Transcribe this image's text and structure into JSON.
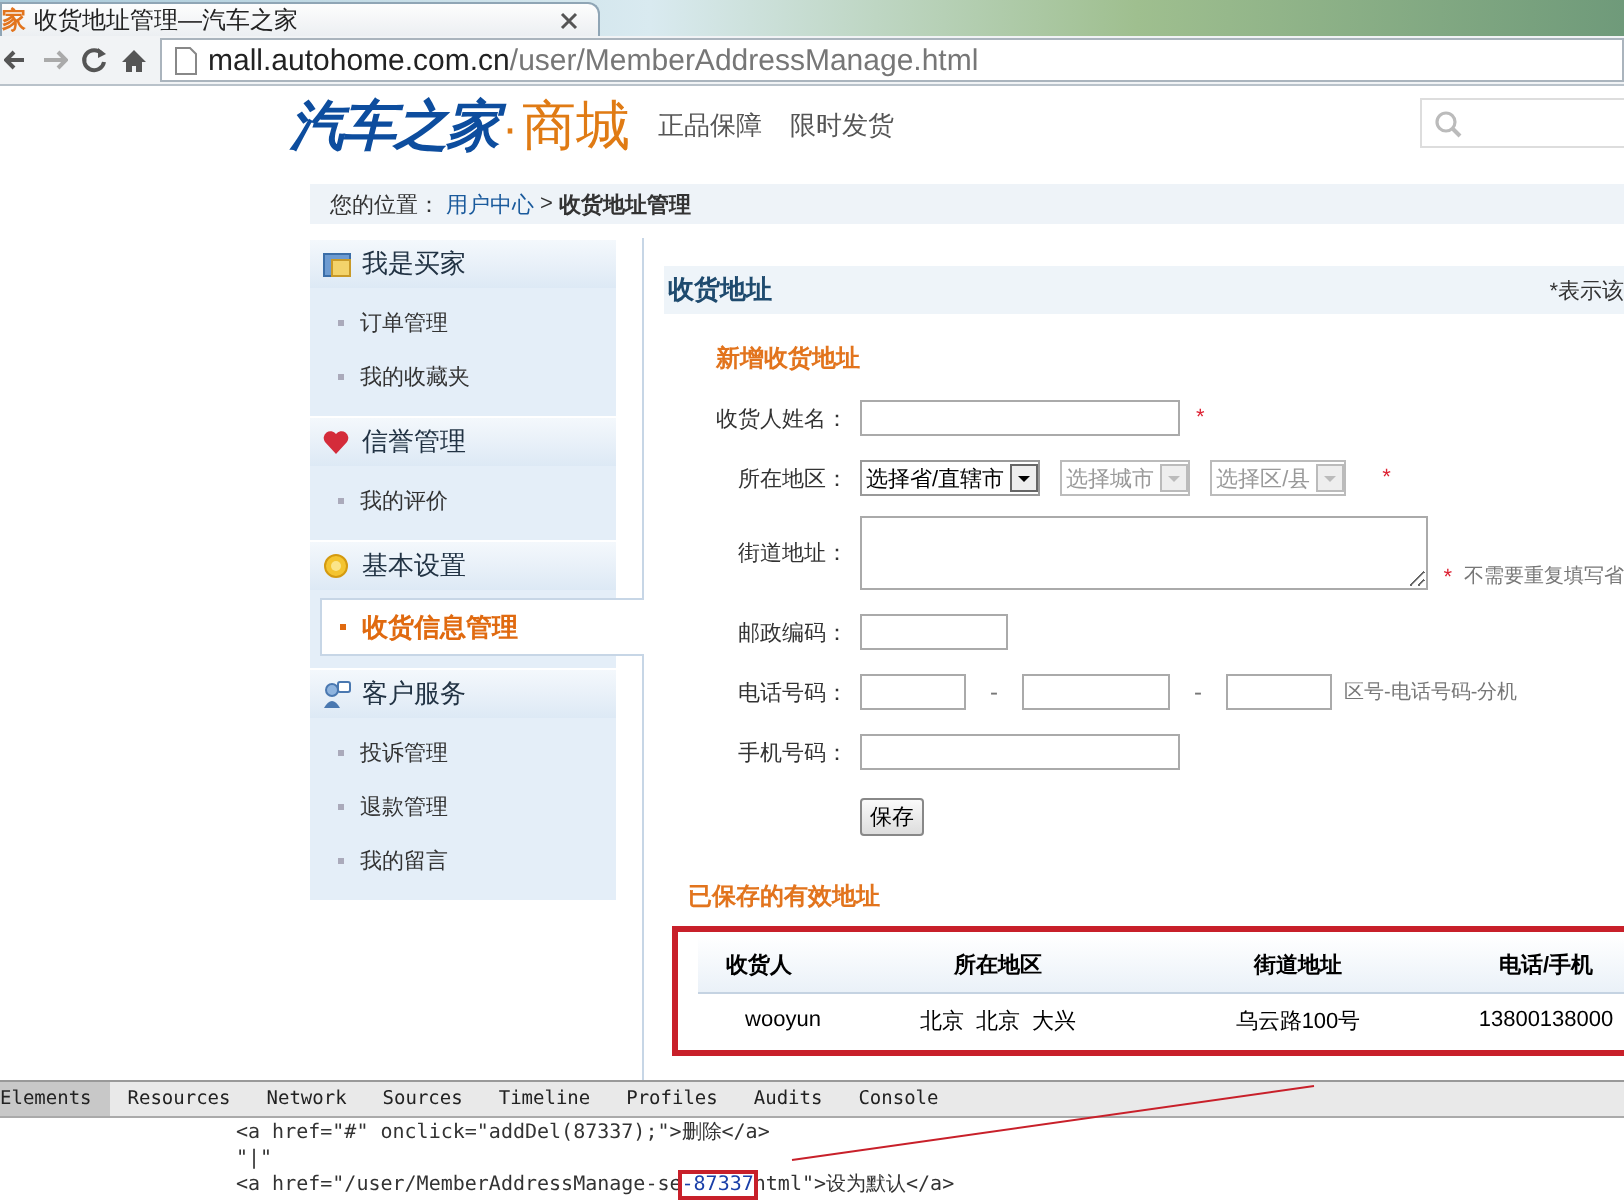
{
  "browser": {
    "tab_icon": "家",
    "tab_title": "收货地址管理—汽车之家",
    "url_host": "mall.autohome.com.cn",
    "url_path": "/user/MemberAddressManage.html"
  },
  "header": {
    "logo_main": "汽车之家",
    "logo_dot": "·",
    "logo_sub": "商城",
    "slogans": [
      "正品保障",
      "限时发货"
    ]
  },
  "breadcrumb": {
    "label": "您的位置：",
    "link": "用户中心",
    "separator": ">",
    "current": "收货地址管理"
  },
  "sidebar": {
    "sections": [
      {
        "title": "我是买家",
        "items": [
          {
            "label": "订单管理",
            "selected": false
          },
          {
            "label": "我的收藏夹",
            "selected": false
          }
        ]
      },
      {
        "title": "信誉管理",
        "items": [
          {
            "label": "我的评价",
            "selected": false
          }
        ]
      },
      {
        "title": "基本设置",
        "items": [
          {
            "label": "收货信息管理",
            "selected": true
          }
        ]
      },
      {
        "title": "客户服务",
        "items": [
          {
            "label": "投诉管理",
            "selected": false
          },
          {
            "label": "退款管理",
            "selected": false
          },
          {
            "label": "我的留言",
            "selected": false
          }
        ]
      }
    ]
  },
  "form": {
    "title": "收货地址",
    "note": "*表示该",
    "section": "新增收货地址",
    "required_mark": "*",
    "fields": [
      {
        "kind": "text",
        "label": "收货人姓名：",
        "required": true
      },
      {
        "kind": "select",
        "label": "所在地区：",
        "required": true,
        "selects": [
          {
            "value": "选择省/直辖市",
            "disabled": false
          },
          {
            "value": "选择城市",
            "disabled": true
          },
          {
            "value": "选择区/县",
            "disabled": true
          }
        ]
      },
      {
        "kind": "textarea",
        "label": "街道地址：",
        "required": true,
        "hint": "不需要重复填写省"
      },
      {
        "kind": "short",
        "label": "邮政编码：",
        "required": false
      },
      {
        "kind": "phone",
        "label": "电话号码：",
        "required": false,
        "separators": [
          "-",
          "-"
        ],
        "hint": "区号-电话号码-分机"
      },
      {
        "kind": "text",
        "label": "手机号码：",
        "required": false
      }
    ],
    "button": "保存"
  },
  "saved": {
    "title": "已保存的有效地址",
    "highlighted": true,
    "columns": [
      "收货人",
      "所在地区",
      "街道地址",
      "电话/手机"
    ],
    "rows": [
      [
        "wooyun",
        "北京  北京  大兴",
        "乌云路100号",
        "13800138000"
      ]
    ]
  },
  "devtools": {
    "tabs": [
      {
        "label": "Elements",
        "selected": true
      },
      {
        "label": "Resources",
        "selected": false
      },
      {
        "label": "Network",
        "selected": false
      },
      {
        "label": "Sources",
        "selected": false
      },
      {
        "label": "Timeline",
        "selected": false
      },
      {
        "label": "Profiles",
        "selected": false
      },
      {
        "label": "Audits",
        "selected": false
      },
      {
        "label": "Console",
        "selected": false
      }
    ],
    "lines": [
      {
        "parts": [
          {
            "text": "<a href=\"#\" onclick=\"addDel(87337);\">删除</a>",
            "marked": false
          }
        ]
      },
      {
        "parts": [
          {
            "text": "\"|\"",
            "marked": false
          }
        ]
      },
      {
        "parts": [
          {
            "text": "<a href=\"/user/MemberAddressManage-se",
            "marked": false
          },
          {
            "text": "-87337",
            "marked": true
          },
          {
            "text": "html\">设为默认</a>",
            "marked": false
          }
        ]
      }
    ]
  }
}
